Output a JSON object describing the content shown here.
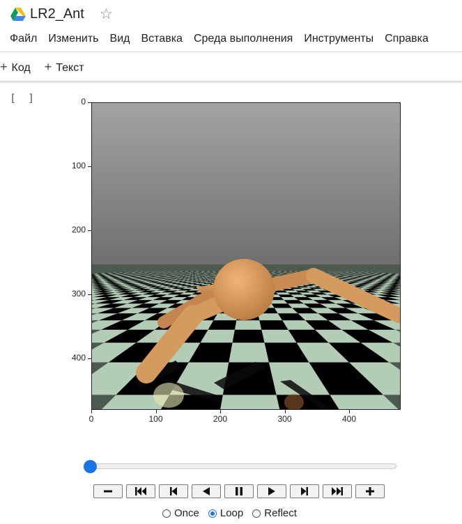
{
  "header": {
    "title": "LR2_Ant",
    "logo_icon": "google-drive-icon",
    "star_icon": "star-icon"
  },
  "menu": [
    "Файл",
    "Изменить",
    "Вид",
    "Вставка",
    "Среда выполнения",
    "Инструменты",
    "Справка"
  ],
  "toolbar": {
    "add_code_label": "Код",
    "add_text_label": "Текст"
  },
  "cell": {
    "run_indicator": "[ ]"
  },
  "plot": {
    "y_ticks": [
      "0",
      "100",
      "200",
      "300",
      "400"
    ],
    "x_ticks": [
      "0",
      "100",
      "200",
      "300",
      "400"
    ],
    "xlim": [
      0,
      480
    ],
    "ylim": [
      0,
      480
    ],
    "colors": {
      "sky_top": "#a3a3a3",
      "sky_bottom": "#6e706f",
      "tile_light": "#b3ccb5",
      "tile_dark": "#000000",
      "ant_body": "#d49a5e"
    }
  },
  "animation": {
    "frame_position": 0,
    "buttons": [
      "decrease-speed",
      "first-frame",
      "previous-frame",
      "play-reverse",
      "pause",
      "play",
      "next-frame",
      "last-frame",
      "increase-speed"
    ],
    "modes": [
      "Once",
      "Loop",
      "Reflect"
    ],
    "selected_mode": "Loop"
  }
}
